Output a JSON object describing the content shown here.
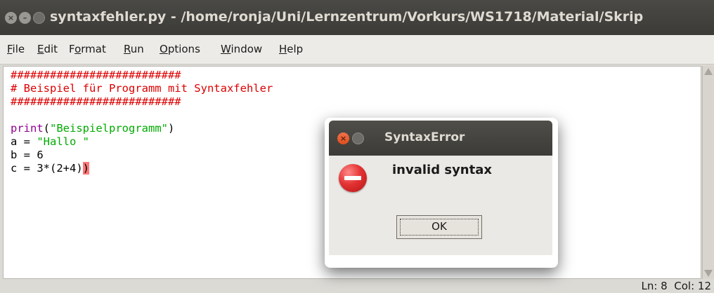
{
  "window": {
    "title": "syntaxfehler.py - /home/ronja/Uni/Lernzentrum/Vorkurs/WS1718/Material/Skrip"
  },
  "menu": [
    {
      "label": "File",
      "ul": "F",
      "rest": "ile"
    },
    {
      "label": "Edit",
      "ul": "E",
      "rest": "dit"
    },
    {
      "label": "Format",
      "pre": "F",
      "ul": "o",
      "rest": "rmat"
    },
    {
      "label": "Run",
      "ul": "R",
      "rest": "un"
    },
    {
      "label": "Options",
      "ul": "O",
      "rest": "ptions"
    },
    {
      "label": "Window",
      "ul": "W",
      "rest": "indow"
    },
    {
      "label": "Help",
      "ul": "H",
      "rest": "elp"
    }
  ],
  "code": {
    "lines": [
      "##########################",
      "# Beispiel für Programm mit Syntaxfehler",
      "##########################",
      "",
      "print(\"Beispielprogramm\")",
      "a = \"Hallo \"",
      "b = 6",
      "c = 3*(2+4))"
    ]
  },
  "status": {
    "text": "Ln: 8  Col: 12"
  },
  "dialog": {
    "title": "SyntaxError",
    "message": "invalid syntax",
    "ok_label": "OK",
    "icon": "error-icon"
  },
  "colors": {
    "comment": "#dd0000",
    "string": "#00aa00",
    "builtin": "#900090",
    "error_highlight": "#ff7777"
  }
}
